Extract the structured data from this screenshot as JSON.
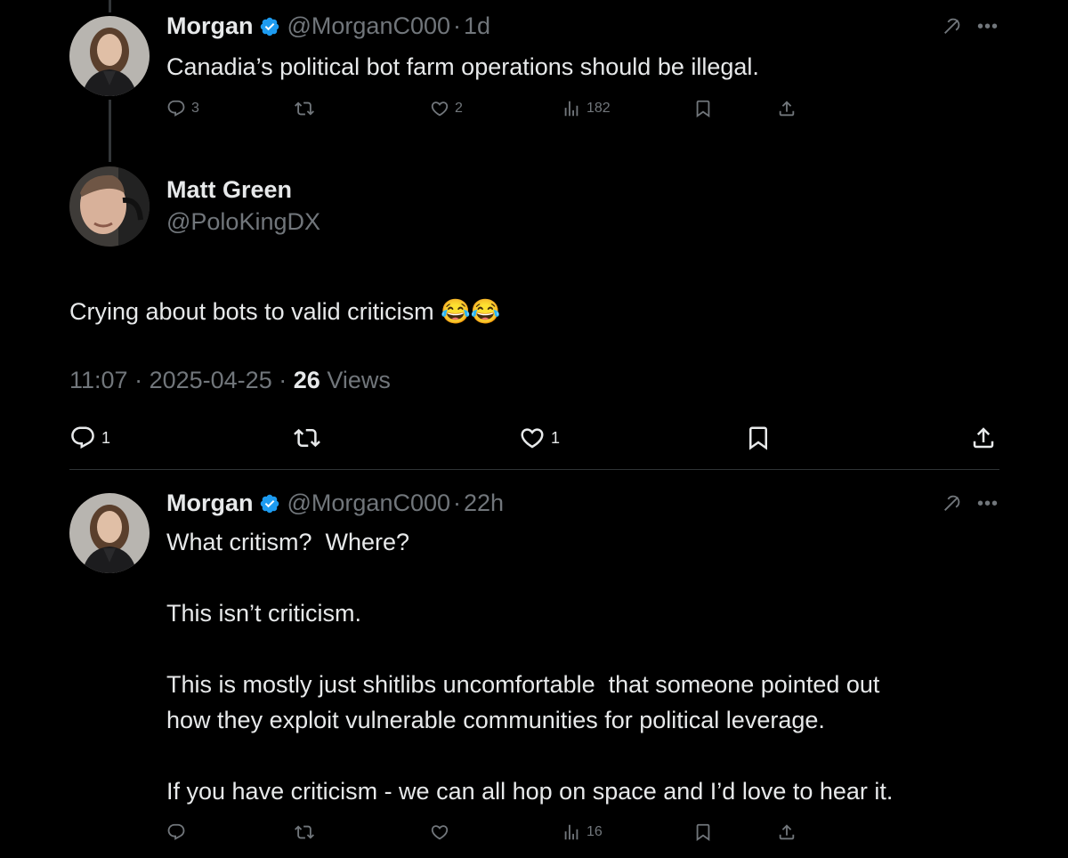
{
  "tweets": [
    {
      "name": "Morgan",
      "handle": "@MorganC000",
      "sep": "·",
      "time": "1d",
      "text": "Canadia’s political bot farm operations should be illegal.",
      "replies": "3",
      "retweets": "",
      "likes": "2",
      "views": "182"
    },
    {
      "name": "Matt Green",
      "handle": "@PoloKingDX",
      "text": "Crying about bots to valid criticism 😂😂",
      "time": "11:07",
      "date": "2025-04-25",
      "sep": "·",
      "views_count": "26",
      "views_label": "Views",
      "replies": "1",
      "retweets": "",
      "likes": "1"
    },
    {
      "name": "Morgan",
      "handle": "@MorganC000",
      "sep": "·",
      "time": "22h",
      "text": "What critism?  Where?\n\nThis isn’t criticism.\n\nThis is mostly just shitlibs uncomfortable  that someone pointed out\nhow they exploit vulnerable communities for political leverage.\n\nIf you have criticism - we can all hop on space and I’d love to hear it.",
      "replies": "",
      "retweets": "",
      "likes": "",
      "views": "16"
    }
  ],
  "icons": {
    "verified": "verified-badge-icon",
    "grok": "grok-icon",
    "more": "more-icon",
    "reply": "reply-icon",
    "retweet": "retweet-icon",
    "like": "like-icon",
    "views": "views-icon",
    "bookmark": "bookmark-icon",
    "share": "share-icon"
  },
  "colors": {
    "background": "#000000",
    "text": "#e7e9ea",
    "muted": "#71767b",
    "verified": "#1d9bf0"
  }
}
